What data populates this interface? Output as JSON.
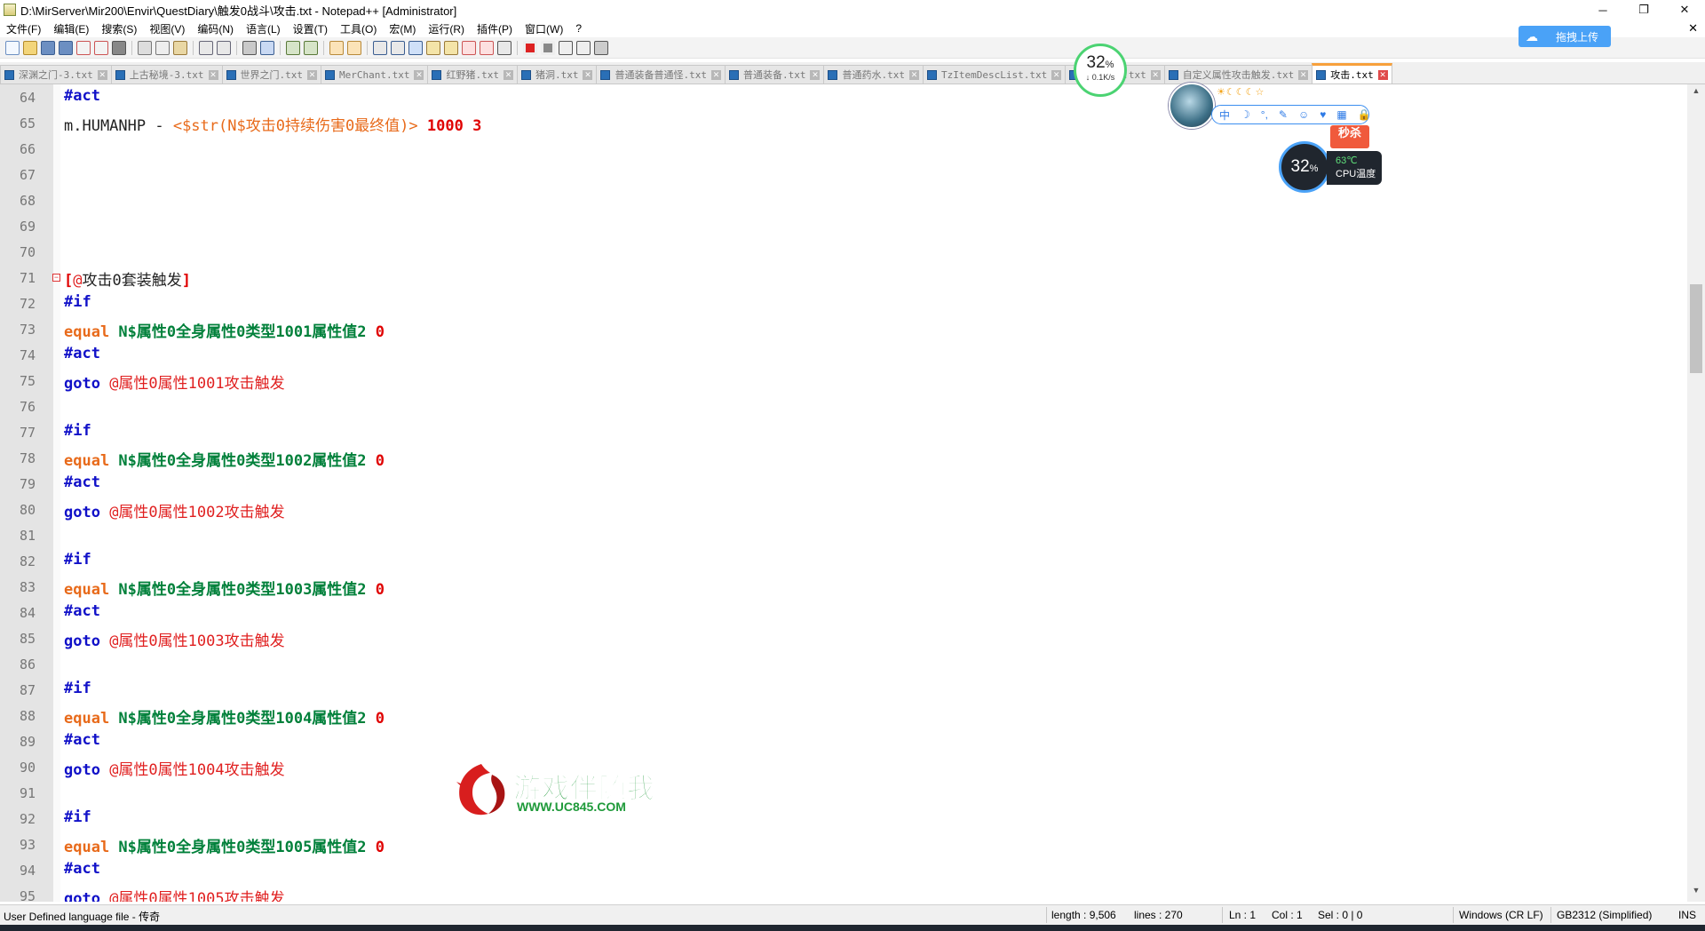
{
  "window": {
    "title": "D:\\MirServer\\Mir200\\Envir\\QuestDiary\\触发0战斗\\攻击.txt - Notepad++ [Administrator]",
    "minimize": "─",
    "restore": "❐",
    "close": "✕"
  },
  "menu": [
    "文件(F)",
    "编辑(E)",
    "搜索(S)",
    "视图(V)",
    "编码(N)",
    "语言(L)",
    "设置(T)",
    "工具(O)",
    "宏(M)",
    "运行(R)",
    "插件(P)",
    "窗口(W)",
    "?"
  ],
  "menu_close": "✕",
  "tabs": [
    {
      "label": "深渊之门-3.txt"
    },
    {
      "label": "上古秘境-3.txt"
    },
    {
      "label": "世界之门.txt"
    },
    {
      "label": "MerChant.txt"
    },
    {
      "label": "红野猪.txt"
    },
    {
      "label": "猪洞.txt"
    },
    {
      "label": "普通装备普通怪.txt"
    },
    {
      "label": "普通装备.txt"
    },
    {
      "label": "普通药水.txt"
    },
    {
      "label": "TzItemDescList.txt"
    },
    {
      "label": "套装触发.txt"
    },
    {
      "label": "自定义属性攻击触发.txt"
    },
    {
      "label": "攻击.txt",
      "active": true
    }
  ],
  "tab_close": "✕",
  "editor": {
    "lines": [
      {
        "n": "64",
        "t": [
          {
            "c": "kw",
            "s": "#act"
          }
        ]
      },
      {
        "n": "65",
        "t": [
          {
            "c": "plain",
            "s": "m.HUMANHP - "
          },
          {
            "c": "op",
            "s": "<$str(N$攻击0持续伤害0最终值)>"
          },
          {
            "c": "num",
            "s": " 1000 3"
          }
        ]
      },
      {
        "n": "66",
        "t": []
      },
      {
        "n": "67",
        "t": []
      },
      {
        "n": "68",
        "t": []
      },
      {
        "n": "69",
        "t": []
      },
      {
        "n": "70",
        "t": []
      },
      {
        "n": "71",
        "fold": true,
        "t": [
          {
            "c": "br",
            "s": "["
          },
          {
            "c": "lbl",
            "s": "@"
          },
          {
            "c": "plain",
            "s": "攻击0套装触发"
          },
          {
            "c": "br",
            "s": "]"
          }
        ]
      },
      {
        "n": "72",
        "t": [
          {
            "c": "kw",
            "s": "#if"
          }
        ]
      },
      {
        "n": "73",
        "t": [
          {
            "c": "kw2",
            "s": "equal "
          },
          {
            "c": "var",
            "s": "N$属性0全身属性0类型1001属性值2 "
          },
          {
            "c": "num",
            "s": "0"
          }
        ]
      },
      {
        "n": "74",
        "t": [
          {
            "c": "kw",
            "s": "#act"
          }
        ]
      },
      {
        "n": "75",
        "t": [
          {
            "c": "kw",
            "s": "goto "
          },
          {
            "c": "lbl",
            "s": "@属性0属性1001攻击触发"
          }
        ]
      },
      {
        "n": "76",
        "t": []
      },
      {
        "n": "77",
        "t": [
          {
            "c": "kw",
            "s": "#if"
          }
        ]
      },
      {
        "n": "78",
        "t": [
          {
            "c": "kw2",
            "s": "equal "
          },
          {
            "c": "var",
            "s": "N$属性0全身属性0类型1002属性值2 "
          },
          {
            "c": "num",
            "s": "0"
          }
        ]
      },
      {
        "n": "79",
        "t": [
          {
            "c": "kw",
            "s": "#act"
          }
        ]
      },
      {
        "n": "80",
        "t": [
          {
            "c": "kw",
            "s": "goto "
          },
          {
            "c": "lbl",
            "s": "@属性0属性1002攻击触发"
          }
        ]
      },
      {
        "n": "81",
        "t": []
      },
      {
        "n": "82",
        "t": [
          {
            "c": "kw",
            "s": "#if"
          }
        ]
      },
      {
        "n": "83",
        "t": [
          {
            "c": "kw2",
            "s": "equal "
          },
          {
            "c": "var",
            "s": "N$属性0全身属性0类型1003属性值2 "
          },
          {
            "c": "num",
            "s": "0"
          }
        ]
      },
      {
        "n": "84",
        "t": [
          {
            "c": "kw",
            "s": "#act"
          }
        ]
      },
      {
        "n": "85",
        "t": [
          {
            "c": "kw",
            "s": "goto "
          },
          {
            "c": "lbl",
            "s": "@属性0属性1003攻击触发"
          }
        ]
      },
      {
        "n": "86",
        "t": []
      },
      {
        "n": "87",
        "t": [
          {
            "c": "kw",
            "s": "#if"
          }
        ]
      },
      {
        "n": "88",
        "t": [
          {
            "c": "kw2",
            "s": "equal "
          },
          {
            "c": "var",
            "s": "N$属性0全身属性0类型1004属性值2 "
          },
          {
            "c": "num",
            "s": "0"
          }
        ]
      },
      {
        "n": "89",
        "t": [
          {
            "c": "kw",
            "s": "#act"
          }
        ]
      },
      {
        "n": "90",
        "t": [
          {
            "c": "kw",
            "s": "goto "
          },
          {
            "c": "lbl",
            "s": "@属性0属性1004攻击触发"
          }
        ]
      },
      {
        "n": "91",
        "t": []
      },
      {
        "n": "92",
        "t": [
          {
            "c": "kw",
            "s": "#if"
          }
        ]
      },
      {
        "n": "93",
        "t": [
          {
            "c": "kw2",
            "s": "equal "
          },
          {
            "c": "var",
            "s": "N$属性0全身属性0类型1005属性值2 "
          },
          {
            "c": "num",
            "s": "0"
          }
        ]
      },
      {
        "n": "94",
        "t": [
          {
            "c": "kw",
            "s": "#act"
          }
        ]
      },
      {
        "n": "95",
        "t": [
          {
            "c": "kw",
            "s": "goto "
          },
          {
            "c": "lbl",
            "s": "@属性0属性1005攻击触发"
          }
        ]
      }
    ]
  },
  "status": {
    "filetype": "User Defined language file - 传奇",
    "length": "length : 9,506",
    "lines": "lines : 270",
    "ln": "Ln : 1",
    "col": "Col : 1",
    "sel": "Sel : 0 | 0",
    "eol": "Windows (CR LF)",
    "encoding": "GB2312 (Simplified)",
    "mode": "INS"
  },
  "overlays": {
    "net_percent": "32",
    "net_percent_unit": "%",
    "net_speed": "↓ 0.1K/s",
    "upload_label": "拖拽上传",
    "upload_icon": "☁",
    "stars": "☀☾☾☾☆",
    "ime_items": [
      "中",
      "☽",
      "°,",
      "✎",
      "☺",
      "♥",
      "▦",
      "🔒"
    ],
    "sale_badge": "秒杀",
    "cpu_percent": "32",
    "cpu_percent_unit": "%",
    "cpu_temp": "63℃",
    "cpu_temp_label": "CPU温度"
  },
  "watermark": {
    "title": "游戏伴随我",
    "url": "WWW.UC845.COM"
  },
  "colors": {
    "keyword": "#1010c8",
    "function": "#e86a1a",
    "variable": "#00803a",
    "number": "#e00000",
    "label": "#e02020",
    "active_tab_accent": "#f7a03c",
    "upload_button": "#4aa2f7"
  }
}
